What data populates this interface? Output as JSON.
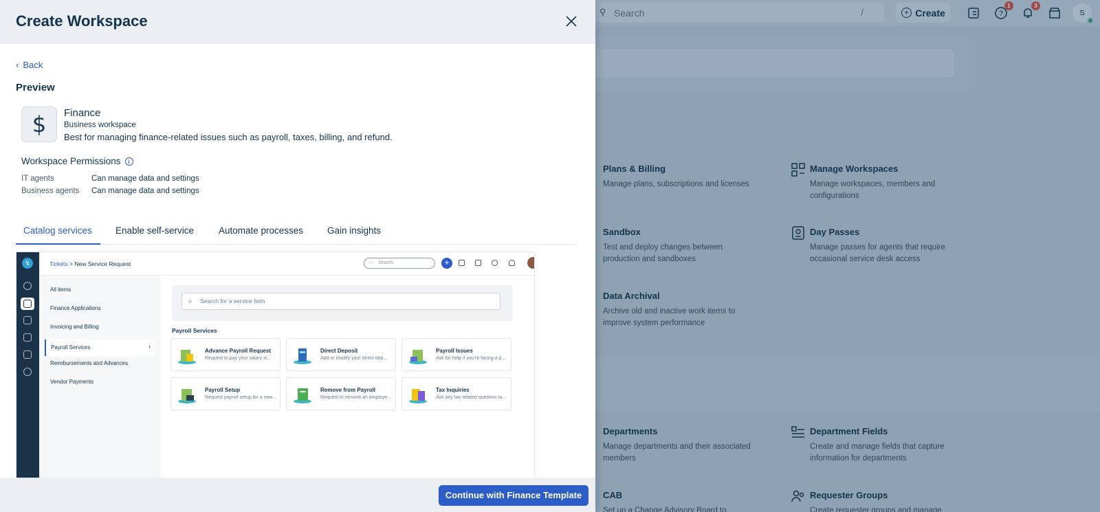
{
  "background": {
    "search_placeholder": "Search",
    "search_shortcut": "/",
    "create_label": "Create",
    "help_badge": "1",
    "notif_badge": "3",
    "avatar_initial": "S",
    "cards": [
      {
        "title": "Plans & Billing",
        "desc": "Manage plans, subscriptions and licenses",
        "icon": "billing-icon"
      },
      {
        "title": "Manage Workspaces",
        "desc": "Manage workspaces, members and configurations",
        "icon": "workspaces-icon"
      },
      {
        "title": "Sandbox",
        "desc": "Test and deploy changes between production and sandboxes",
        "icon": "sandbox-icon"
      },
      {
        "title": "Day Passes",
        "desc": "Manage passes for agents that require occasional service desk access",
        "icon": "day-pass-icon"
      },
      {
        "title": "Data Archival",
        "desc": "Archive old and inactive work items to improve system performance",
        "icon": "archive-icon"
      },
      {
        "title": "Departments",
        "desc": "Manage departments and their associated members",
        "icon": "departments-icon"
      },
      {
        "title": "Department Fields",
        "desc": "Create and manage fields that capture information for departments",
        "icon": "department-fields-icon"
      },
      {
        "title": "CAB",
        "desc": "Set up a Change Advisory Board to",
        "icon": "cab-icon"
      },
      {
        "title": "Requester Groups",
        "desc": "Create requester groups and manage",
        "icon": "requester-groups-icon"
      }
    ]
  },
  "modal": {
    "title": "Create Workspace",
    "back_label": "Back",
    "preview_heading": "Preview",
    "template": {
      "icon_glyph": "$",
      "name": "Finance",
      "type": "Business workspace",
      "description": "Best for managing finance-related issues such as payroll, taxes, billing, and refund."
    },
    "permissions": {
      "heading": "Workspace Permissions",
      "rows": [
        {
          "role": "IT agents",
          "value": "Can manage data and settings"
        },
        {
          "role": "Business agents",
          "value": "Can manage data and settings"
        }
      ]
    },
    "tabs": [
      {
        "label": "Catalog services",
        "active": true
      },
      {
        "label": "Enable self-service",
        "active": false
      },
      {
        "label": "Automate processes",
        "active": false
      },
      {
        "label": "Gain insights",
        "active": false
      }
    ],
    "continue_label": "Continue with Finance Template",
    "accent_color": "#2c5cc5"
  },
  "inner_preview": {
    "breadcrumb_link": "Tickets",
    "breadcrumb_sep": ">",
    "breadcrumb_current": "New Service Request",
    "search_placeholder": "Search",
    "nav_items": [
      "All items",
      "Finance Applications",
      "Invoicing and Billing",
      "Payroll Services",
      "Reimbursements and Advances",
      "Vendor Payments"
    ],
    "service_search_placeholder": "Search for a service Item",
    "section_title": "Payroll Services",
    "services": [
      {
        "title": "Advance Payroll Request",
        "desc": "Request to pay your salary in..."
      },
      {
        "title": "Direct Deposit",
        "desc": "Add or modify your direct dep..."
      },
      {
        "title": "Payroll Issues",
        "desc": "Ask for help if you're facing a p..."
      },
      {
        "title": "Payroll Setup",
        "desc": "Request payroll setup for a new..."
      },
      {
        "title": "Remove from Payroll",
        "desc": "Request to remove an employe..."
      },
      {
        "title": "Tax Inquiries",
        "desc": "Ask any tax-related question to..."
      }
    ]
  }
}
